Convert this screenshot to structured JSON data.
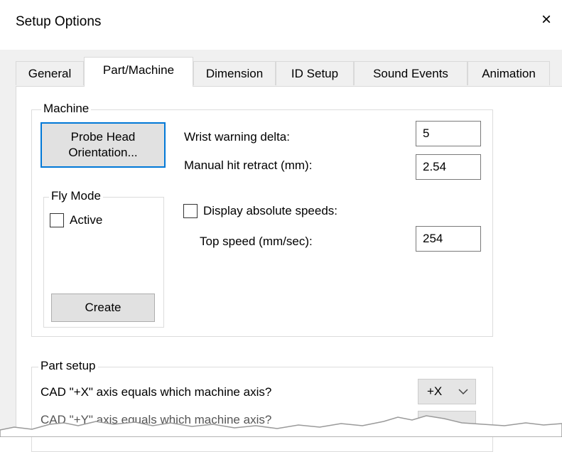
{
  "window": {
    "title": "Setup Options",
    "close_glyph": "×"
  },
  "tabs": [
    {
      "label": "General",
      "active": false
    },
    {
      "label": "Part/Machine",
      "active": true
    },
    {
      "label": "Dimension",
      "active": false
    },
    {
      "label": "ID Setup",
      "active": false
    },
    {
      "label": "Sound Events",
      "active": false
    },
    {
      "label": "Animation",
      "active": false
    }
  ],
  "machine": {
    "legend": "Machine",
    "probe_button": {
      "line1": "Probe Head",
      "line2": "Orientation..."
    },
    "wrist_warning": {
      "label": "Wrist warning delta:",
      "value": "5"
    },
    "manual_hit": {
      "label": "Manual hit retract (mm):",
      "value": "2.54"
    },
    "fly_mode": {
      "legend": "Fly Mode",
      "active_label": "Active",
      "active_checked": false,
      "create_button": "Create"
    },
    "display_speeds": {
      "label": "Display absolute speeds:",
      "checked": false
    },
    "top_speed": {
      "label": "Top speed (mm/sec):",
      "value": "254"
    }
  },
  "part_setup": {
    "legend": "Part setup",
    "x_axis": {
      "label": "CAD \"+X\" axis equals which machine axis?",
      "value": "+X"
    },
    "y_axis_partial": {
      "label": "CAD \"+Y\" axis equals which machine axis?"
    }
  },
  "icons": {
    "close": "close-icon",
    "dropdown": "chevron-down-icon"
  }
}
